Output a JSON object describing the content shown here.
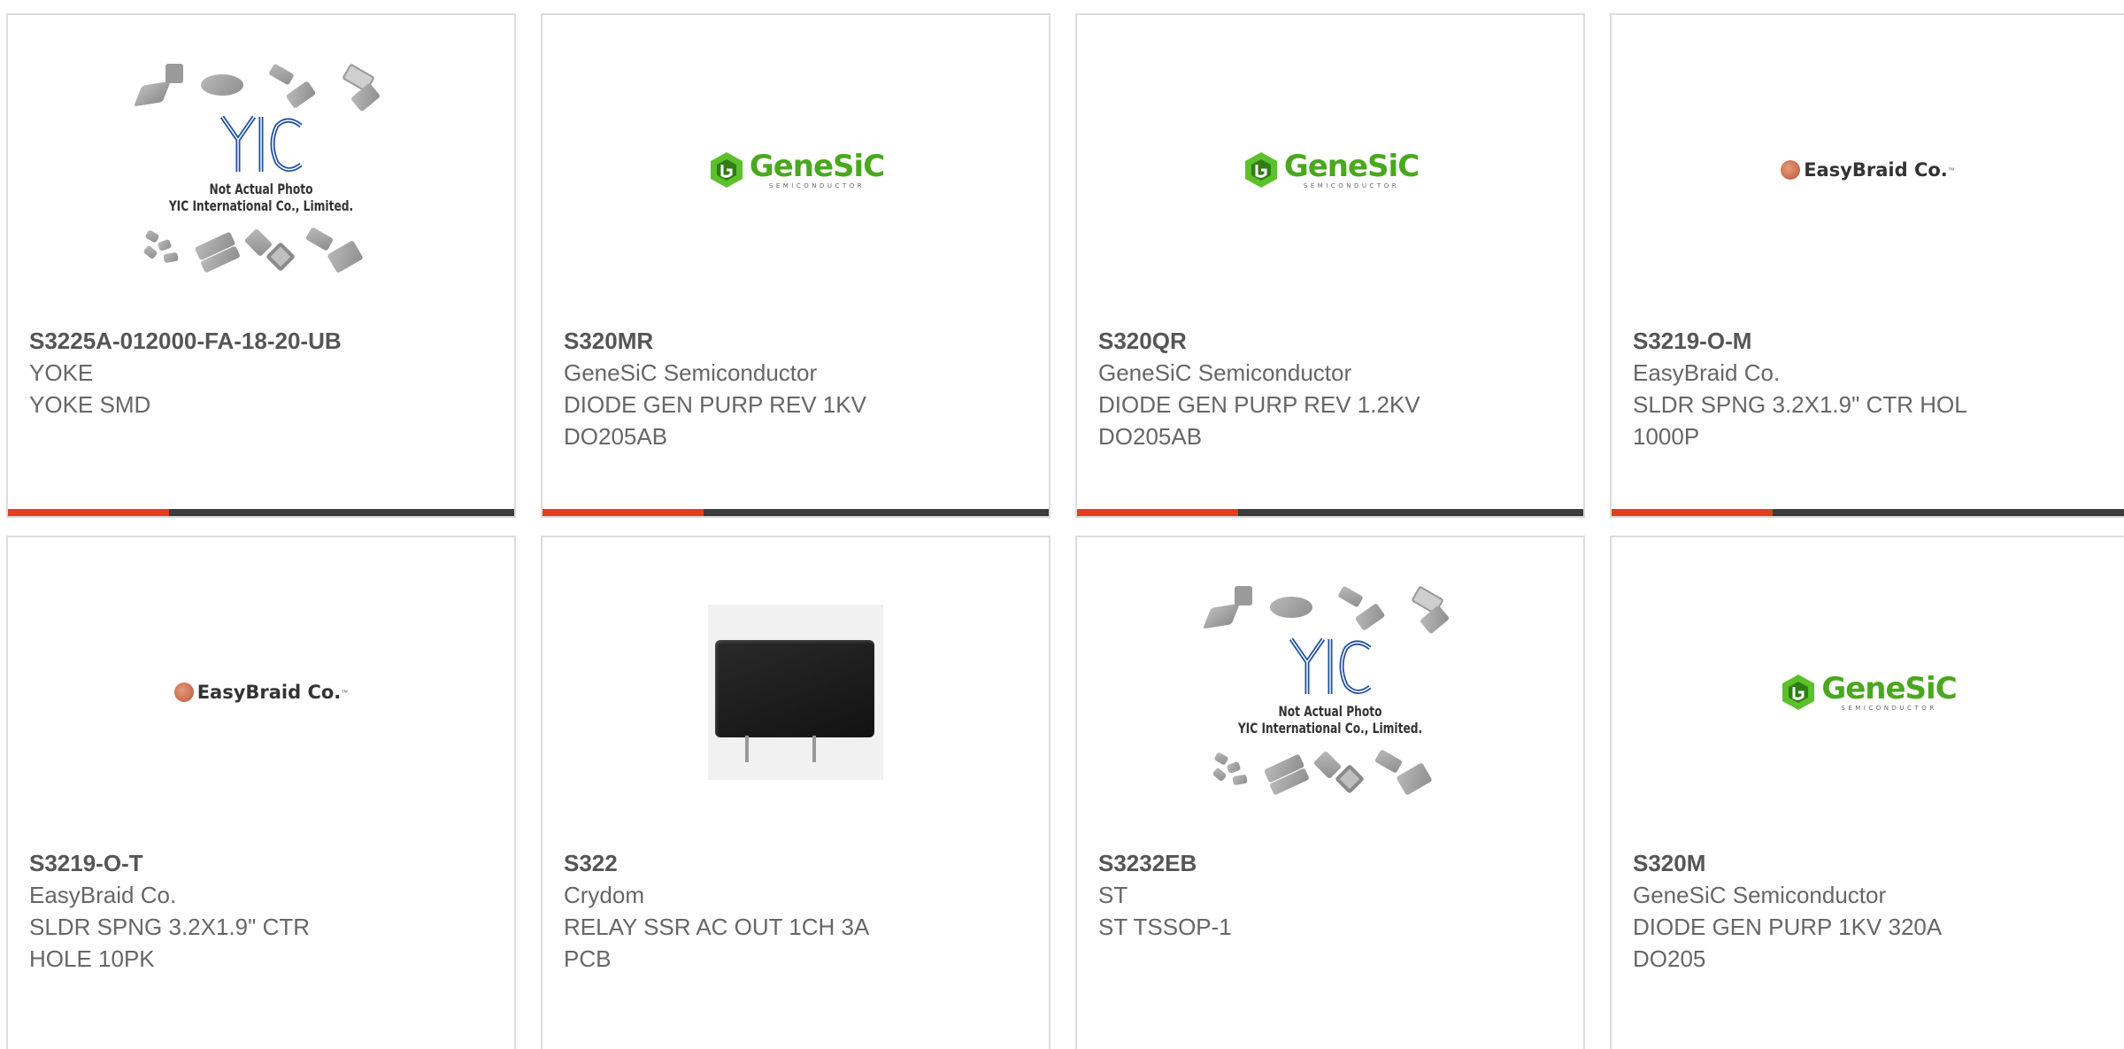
{
  "colors": {
    "accent": "#e2401c",
    "bar": "#3b3b3b",
    "border": "#dcdcdc",
    "text": "#555555"
  },
  "logos": {
    "genesic": {
      "name": "GeneSiC",
      "sub": "SEMICONDUCTOR"
    },
    "easybraid": {
      "name": "EasyBraid Co.",
      "tm": "™"
    },
    "yic": {
      "brand": "YIC",
      "line1": "Not Actual Photo",
      "line2": "YIC International Co., Limited."
    }
  },
  "products": [
    {
      "part": "S3225A-012000-FA-18-20-UB",
      "manufacturer": "YOKE",
      "desc1": "YOKE SMD",
      "desc2": "",
      "image": "yic-placeholder"
    },
    {
      "part": "S320MR",
      "manufacturer": "GeneSiC Semiconductor",
      "desc1": "DIODE GEN PURP REV 1KV",
      "desc2": "DO205AB",
      "image": "genesic-logo"
    },
    {
      "part": "S320QR",
      "manufacturer": "GeneSiC Semiconductor",
      "desc1": "DIODE GEN PURP REV 1.2KV",
      "desc2": "DO205AB",
      "image": "genesic-logo"
    },
    {
      "part": "S3219-O-M",
      "manufacturer": "EasyBraid Co.",
      "desc1": "SLDR SPNG 3.2X1.9\" CTR HOL",
      "desc2": "1000P",
      "image": "easybraid-logo"
    },
    {
      "part": "S3219-O-T",
      "manufacturer": "EasyBraid Co.",
      "desc1": "SLDR SPNG 3.2X1.9\" CTR",
      "desc2": "HOLE 10PK",
      "image": "easybraid-logo"
    },
    {
      "part": "S322",
      "manufacturer": "Crydom",
      "desc1": "RELAY SSR AC OUT 1CH 3A",
      "desc2": "PCB",
      "image": "relay-photo"
    },
    {
      "part": "S3232EB",
      "manufacturer": "ST",
      "desc1": "ST TSSOP-1",
      "desc2": "",
      "image": "yic-placeholder"
    },
    {
      "part": "S320M",
      "manufacturer": "GeneSiC Semiconductor",
      "desc1": "DIODE GEN PURP 1KV 320A",
      "desc2": "DO205",
      "image": "genesic-logo"
    }
  ]
}
